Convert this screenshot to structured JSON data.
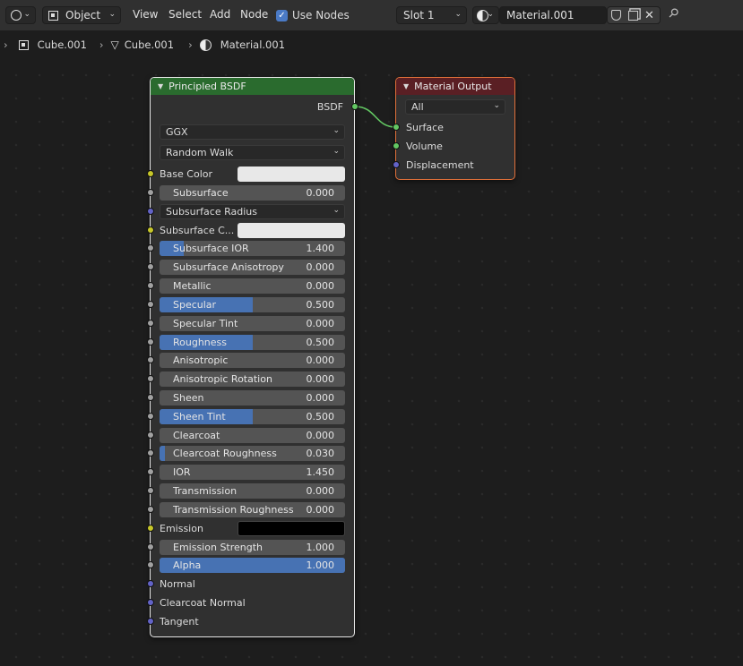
{
  "header": {
    "mode_label": "Object",
    "menus": [
      "View",
      "Select",
      "Add",
      "Node"
    ],
    "use_nodes_label": "Use Nodes",
    "slot_label": "Slot 1",
    "material_name": "Material.001"
  },
  "breadcrumb": {
    "items": [
      "Cube.001",
      "Cube.001",
      "Material.001"
    ]
  },
  "bsdf_node": {
    "title": "Principled BSDF",
    "output_label": "BSDF",
    "distribution": "GGX",
    "subsurface_method": "Random Walk",
    "base_color_label": "Base Color",
    "subsurface_color_label": "Subsurface C...",
    "subsurface_radius_label": "Subsurface Radius",
    "emission_label": "Emission",
    "normal_label": "Normal",
    "clearcoat_normal_label": "Clearcoat Normal",
    "tangent_label": "Tangent",
    "fields": [
      {
        "label": "Subsurface",
        "value": "0.000",
        "fill": 0
      },
      {
        "label": "Subsurface IOR",
        "value": "1.400",
        "fill": 0.13
      },
      {
        "label": "Subsurface Anisotropy",
        "value": "0.000",
        "fill": 0
      },
      {
        "label": "Metallic",
        "value": "0.000",
        "fill": 0
      },
      {
        "label": "Specular",
        "value": "0.500",
        "fill": 0.5
      },
      {
        "label": "Specular Tint",
        "value": "0.000",
        "fill": 0
      },
      {
        "label": "Roughness",
        "value": "0.500",
        "fill": 0.5
      },
      {
        "label": "Anisotropic",
        "value": "0.000",
        "fill": 0
      },
      {
        "label": "Anisotropic Rotation",
        "value": "0.000",
        "fill": 0
      },
      {
        "label": "Sheen",
        "value": "0.000",
        "fill": 0
      },
      {
        "label": "Sheen Tint",
        "value": "0.500",
        "fill": 0.5
      },
      {
        "label": "Clearcoat",
        "value": "0.000",
        "fill": 0
      },
      {
        "label": "Clearcoat Roughness",
        "value": "0.030",
        "fill": 0.03
      },
      {
        "label": "IOR",
        "value": "1.450",
        "fill": 0
      },
      {
        "label": "Transmission",
        "value": "0.000",
        "fill": 0
      },
      {
        "label": "Transmission Roughness",
        "value": "0.000",
        "fill": 0
      },
      {
        "label": "Emission Strength",
        "value": "1.000",
        "fill": 0
      },
      {
        "label": "Alpha",
        "value": "1.000",
        "fill": 1
      }
    ],
    "colors": {
      "base_color": "#e8e8e8",
      "subsurface_color": "#e8e8e8",
      "emission": "#000000"
    }
  },
  "output_node": {
    "title": "Material Output",
    "target": "All",
    "inputs": [
      "Surface",
      "Volume",
      "Displacement"
    ]
  }
}
